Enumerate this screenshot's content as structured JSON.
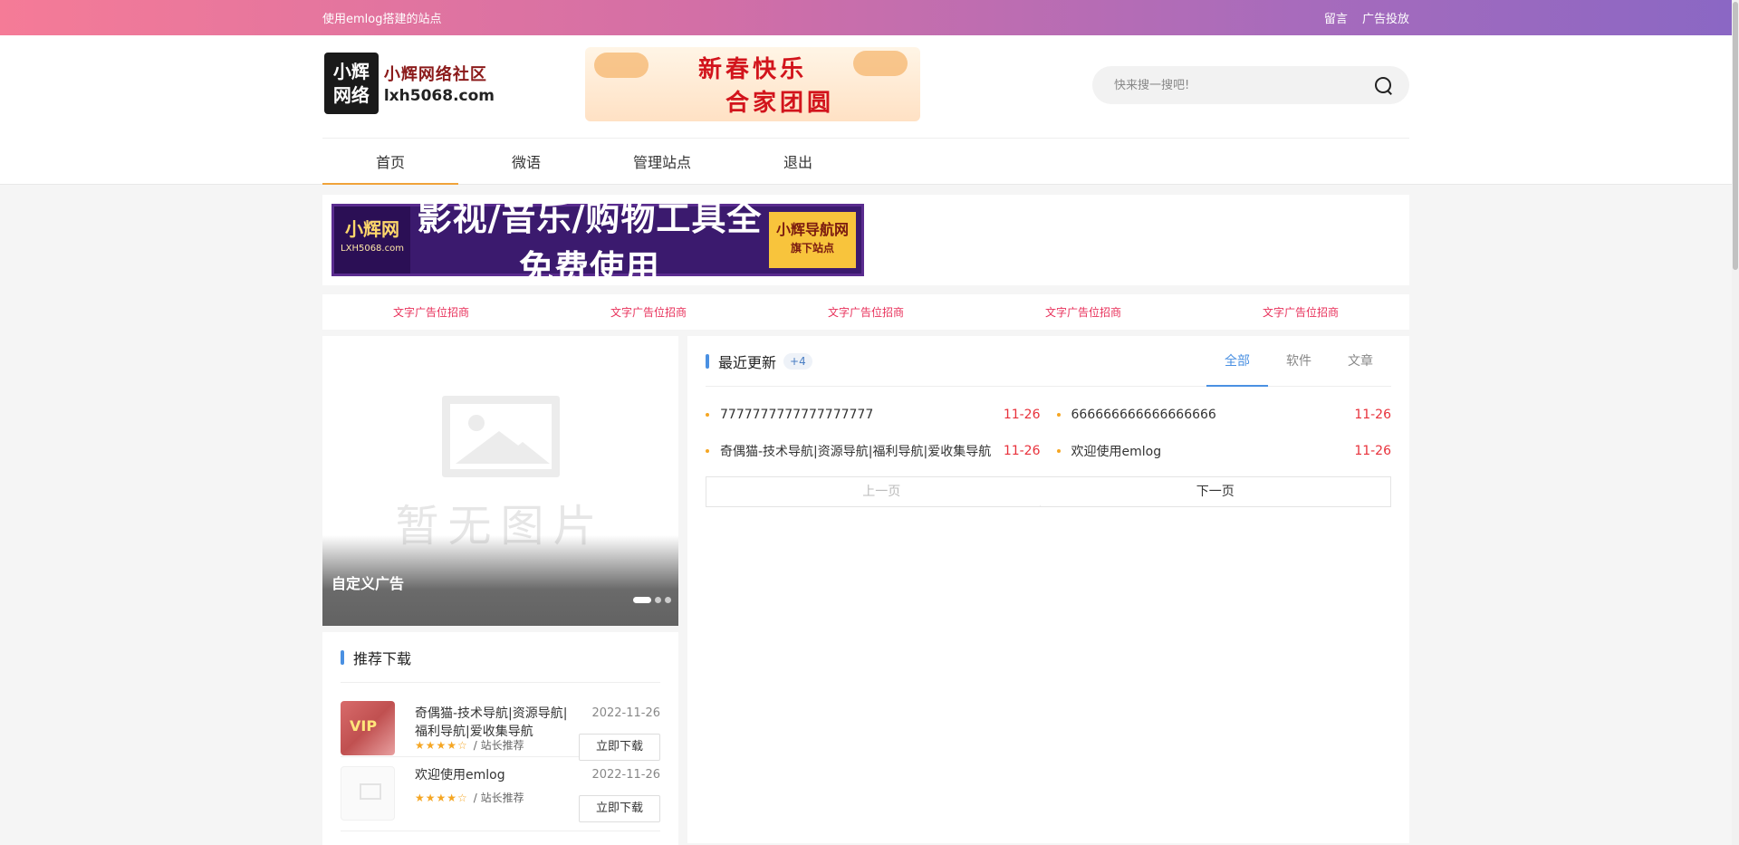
{
  "topbar": {
    "tagline": "使用emlog搭建的站点",
    "links": [
      "留言",
      "广告投放"
    ]
  },
  "logo": {
    "box_line1": "小辉",
    "box_line2": "网络",
    "title": "小辉网络社区",
    "domain": "lxh5068.com"
  },
  "spring_banner": {
    "line1": "新春快乐",
    "line2": "合家团圆"
  },
  "search": {
    "placeholder": "快来搜一搜吧!"
  },
  "nav": {
    "items": [
      "首页",
      "微语",
      "管理站点",
      "退出"
    ],
    "active_index": 0
  },
  "ad_banner": {
    "left_name": "小辉网",
    "left_domain": "LXH5068.com",
    "main_text": "影视/音乐/购物工具全免费使用",
    "right_title": "小辉导航网",
    "right_sub": "旗下站点"
  },
  "text_ads": [
    "文字广告位招商",
    "文字广告位招商",
    "文字广告位招商",
    "文字广告位招商",
    "文字广告位招商"
  ],
  "slider": {
    "placeholder_text": "暂无图片",
    "caption": "自定义广告",
    "dot_count": 3,
    "active_dot": 0
  },
  "recommend": {
    "title": "推荐下载",
    "items": [
      {
        "name": "奇偶猫-技术导航|资源导航|福利导航|爱收集导航",
        "date": "2022-11-26",
        "stars": "★★★★☆",
        "tag": "/ 站长推荐",
        "button": "立即下载",
        "thumb_text": "VIP"
      },
      {
        "name": "欢迎使用emlog",
        "date": "2022-11-26",
        "stars": "★★★★☆",
        "tag": "/ 站长推荐",
        "button": "立即下载",
        "thumb_text": ""
      }
    ]
  },
  "recent": {
    "title": "最近更新",
    "badge": "+4",
    "tabs": [
      "全部",
      "软件",
      "文章"
    ],
    "active_tab": 0,
    "posts": [
      {
        "title": "7777777777777777777",
        "date": "11-26"
      },
      {
        "title": "666666666666666666",
        "date": "11-26"
      },
      {
        "title": "奇偶猫-技术导航|资源导航|福利导航|爱收集导航",
        "date": "11-26"
      },
      {
        "title": "欢迎使用emlog",
        "date": "11-26"
      }
    ],
    "prev_label": "上一页",
    "next_label": "下一页"
  },
  "colors": {
    "accent_orange": "#f0a33a",
    "accent_blue": "#4a90e2",
    "date_red": "#e8313b",
    "ad_pink": "#e8315b"
  }
}
